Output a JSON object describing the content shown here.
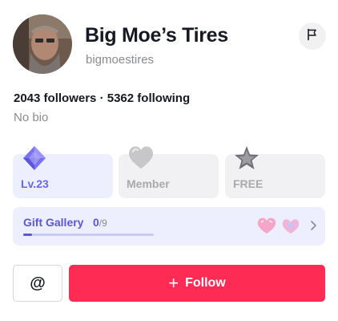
{
  "profile": {
    "name": "Big Moe’s Tires",
    "handle": "bigmoestires",
    "followers": "2043",
    "followers_label": "followers",
    "separator": "·",
    "following": "5362",
    "following_label": "following",
    "bio": "No bio",
    "avatar_icon": "user-avatar-photo",
    "flag_icon": "flag-icon"
  },
  "cards": [
    {
      "label": "Lv.23",
      "icon": "diamond-icon"
    },
    {
      "label": "Member",
      "icon": "heart-icon"
    },
    {
      "label": "FREE",
      "icon": "star-icon"
    }
  ],
  "gift_gallery": {
    "title": "Gift Gallery",
    "count": "0",
    "total": "/9",
    "progress": 0.07
  },
  "actions": {
    "mention_label": "@",
    "follow_label": "Follow",
    "follow_icon": "plus-icon"
  },
  "colors": {
    "accent": "#fe2c55",
    "level": "#6b66e6"
  }
}
